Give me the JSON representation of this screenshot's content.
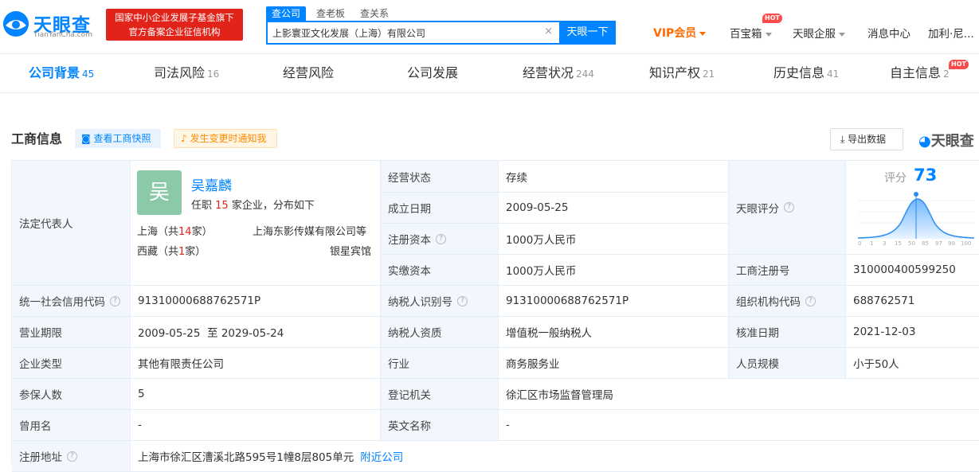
{
  "header": {
    "logo_cn": "天眼查",
    "logo_en": "TianYanCha.com",
    "slogan_line1": "国家中小企业发展子基金旗下",
    "slogan_line2": "官方备案企业征信机构",
    "search_tabs": [
      "查公司",
      "查老板",
      "查关系"
    ],
    "search_value": "上影寰亚文化发展（上海）有限公司",
    "search_clear": "×",
    "search_button": "天眼一下",
    "vip": "VIP会员",
    "toolbox": "百宝箱",
    "hot": "HOT",
    "enterprise": "天眼企服",
    "messages": "消息中心",
    "user": "加利·尼..."
  },
  "tabs": [
    {
      "label": "公司背景",
      "count": "45"
    },
    {
      "label": "司法风险",
      "count": "16"
    },
    {
      "label": "经营风险",
      "count": ""
    },
    {
      "label": "公司发展",
      "count": ""
    },
    {
      "label": "经营状况",
      "count": "244"
    },
    {
      "label": "知识产权",
      "count": "21"
    },
    {
      "label": "历史信息",
      "count": "41"
    },
    {
      "label": "自主信息",
      "count": "2"
    }
  ],
  "section": {
    "title": "工商信息",
    "snapshot_btn": "查看工商快照",
    "notify_btn": "发生变更时通知我",
    "export_btn": "导出数据",
    "watermark": "天眼查"
  },
  "legal": {
    "label": "法定代表人",
    "avatar": "吴",
    "name": "吴嘉麟",
    "desc_pre": "任职",
    "desc_num": "15",
    "desc_post": "家企业，分布如下",
    "region1": "上海（共",
    "region1_num": "14",
    "region1_end": "家）",
    "region1_co": "上海东影传媒有限公司等",
    "region2": "西藏（共",
    "region2_num": "1",
    "region2_end": "家）",
    "region2_co": "银星宾馆"
  },
  "status": {
    "label": "经营状态",
    "value": "存续"
  },
  "found": {
    "label": "成立日期",
    "value": "2009-05-25"
  },
  "regcap": {
    "label": "注册资本",
    "value": "1000万人民币"
  },
  "paidcap": {
    "label": "实缴资本",
    "value": "1000万人民币"
  },
  "score": {
    "label": "天眼评分",
    "score_label": "评分",
    "score": "73",
    "axis": [
      "0",
      "1",
      "3",
      "15",
      "50",
      "85",
      "97",
      "99",
      "100"
    ]
  },
  "regno": {
    "label": "工商注册号",
    "value": "310000400599250"
  },
  "credit": {
    "label": "统一社会信用代码",
    "value": "91310000688762571P"
  },
  "taxid": {
    "label": "纳税人识别号",
    "value": "91310000688762571P"
  },
  "orgcode": {
    "label": "组织机构代码",
    "value": "688762571"
  },
  "term": {
    "label": "营业期限",
    "value": "2009-05-25  至 2029-05-24"
  },
  "taxqual": {
    "label": "纳税人资质",
    "value": "增值税一般纳税人"
  },
  "approve": {
    "label": "核准日期",
    "value": "2021-12-03"
  },
  "type": {
    "label": "企业类型",
    "value": "其他有限责任公司"
  },
  "industry": {
    "label": "行业",
    "value": "商务服务业"
  },
  "staff": {
    "label": "人员规模",
    "value": "小于50人"
  },
  "insured": {
    "label": "参保人数",
    "value": "5"
  },
  "authority": {
    "label": "登记机关",
    "value": "徐汇区市场监督管理局"
  },
  "oldname": {
    "label": "曾用名",
    "value": "-"
  },
  "engname": {
    "label": "英文名称",
    "value": "-"
  },
  "address": {
    "label": "注册地址",
    "value": "上海市徐汇区漕溪北路595号1幢8层805单元",
    "link": "附近公司"
  },
  "colors": {
    "brand": "#0084ff",
    "red": "#e2231a",
    "label_bg": "#f2f7fd"
  }
}
